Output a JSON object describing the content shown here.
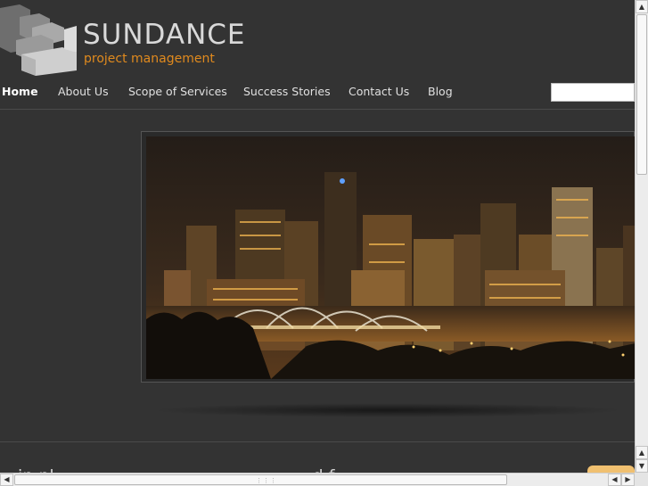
{
  "brand": {
    "name": "SUNDANCE",
    "tagline": "project management",
    "accent_color": "#e08a1e"
  },
  "nav": {
    "items": [
      {
        "label": "Home",
        "active": true
      },
      {
        "label": "About Us"
      },
      {
        "label": "Scope of Services"
      },
      {
        "label": "Success Stories"
      },
      {
        "label": "Contact Us"
      },
      {
        "label": "Blog"
      }
    ]
  },
  "search": {
    "value": ""
  },
  "hero": {
    "image": "city-skyline-night-photo"
  },
  "content": {
    "text": "in pl ................ ...... ................. .....d f.... .................... .... .... .... .... .... ...... ..... f..."
  },
  "icons": {
    "logo": "stacked-blocks-logo-icon",
    "scroll_up": "arrow-up-icon",
    "scroll_down": "arrow-down-icon",
    "scroll_left": "arrow-left-icon",
    "scroll_right": "arrow-right-icon"
  }
}
